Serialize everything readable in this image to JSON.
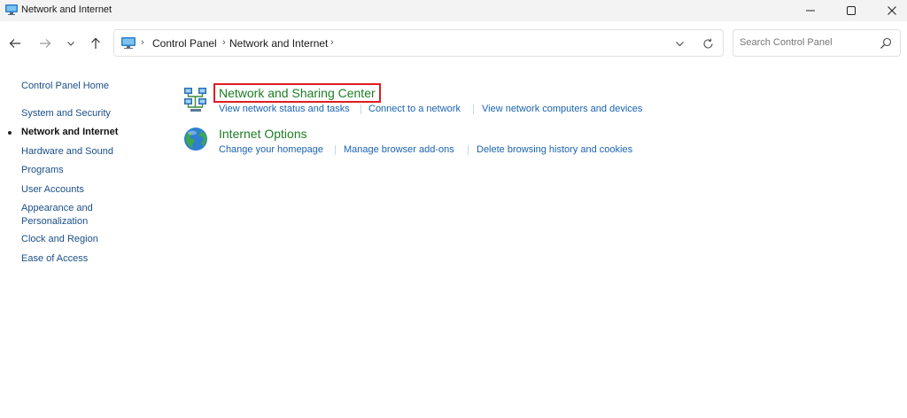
{
  "window": {
    "title": "Network and Internet"
  },
  "address_bar": {
    "crumbs": [
      "Control Panel",
      "Network and Internet"
    ]
  },
  "search": {
    "placeholder": "Search Control Panel"
  },
  "sidebar": {
    "home": "Control Panel Home",
    "items": [
      {
        "label": "System and Security"
      },
      {
        "label": "Network and Internet",
        "current": true
      },
      {
        "label": "Hardware and Sound"
      },
      {
        "label": "Programs"
      },
      {
        "label": "User Accounts"
      },
      {
        "label": "Appearance and Personalization"
      },
      {
        "label": "Clock and Region"
      },
      {
        "label": "Ease of Access"
      }
    ]
  },
  "categories": [
    {
      "title": "Network and Sharing Center",
      "icon": "network-sharing-icon",
      "highlighted": true,
      "tasks": [
        "View network status and tasks",
        "Connect to a network",
        "View network computers and devices"
      ]
    },
    {
      "title": "Internet Options",
      "icon": "globe-icon",
      "tasks": [
        "Change your homepage",
        "Manage browser add-ons",
        "Delete browsing history and cookies"
      ]
    }
  ],
  "colors": {
    "category_title": "#1e7d24",
    "task_link": "#1a63b0",
    "sidebar_link": "#1a4f8a",
    "highlight_box": "#e21b22"
  }
}
